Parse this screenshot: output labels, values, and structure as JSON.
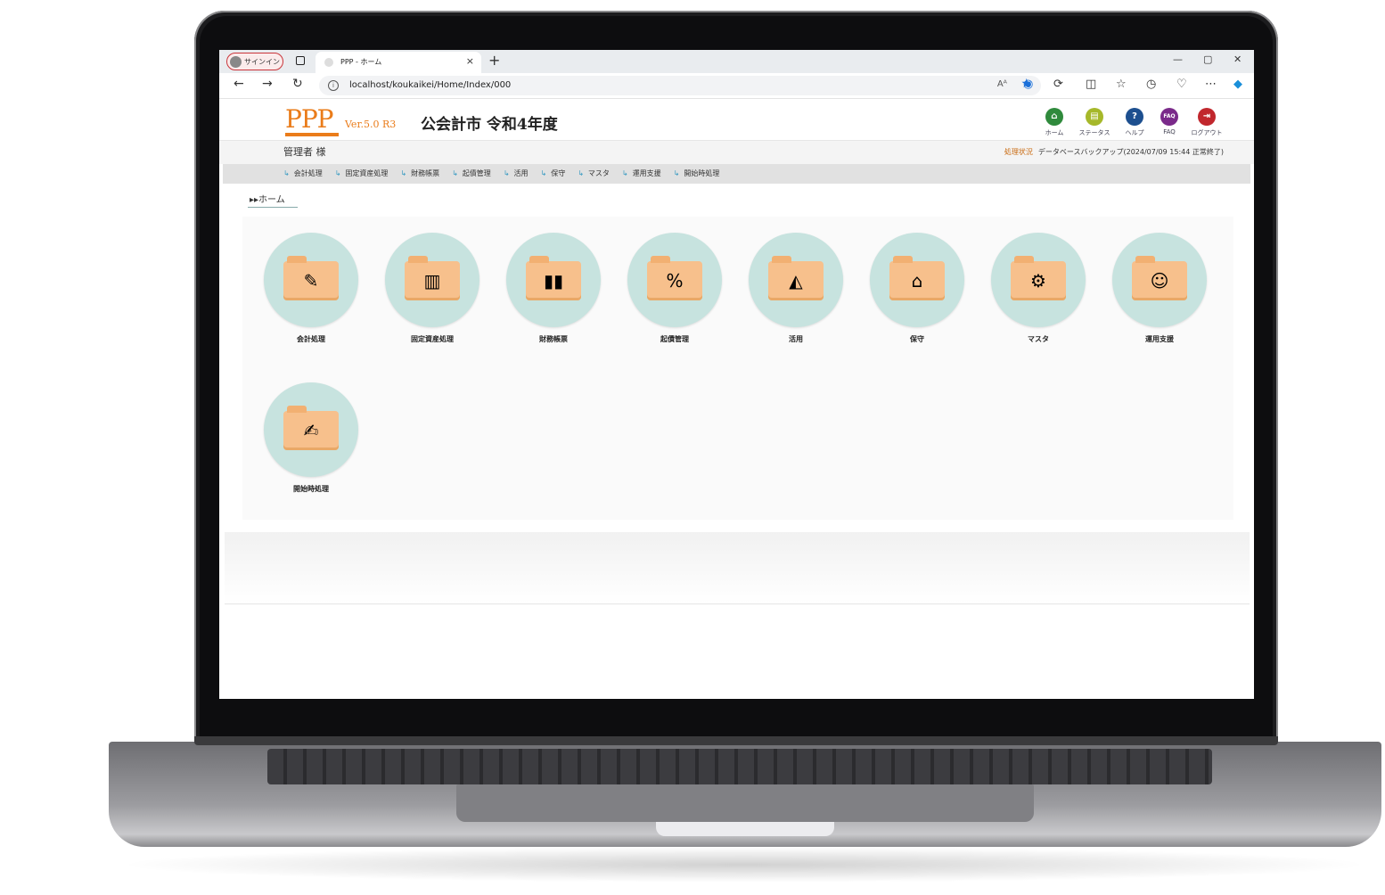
{
  "browser": {
    "signin_label": "サインイン",
    "tab_title": "PPP - ホーム",
    "tab_close": "×",
    "new_tab": "+",
    "url": "localhost/koukaikei/Home/Index/000",
    "read_aloud": "Aᴬ",
    "minimize": "—",
    "maximize": "▢",
    "close": "✕"
  },
  "app": {
    "logo": "PPP",
    "version": "Ver.5.0 R3",
    "city_title": "公会計市  令和4年度",
    "user": "管理者 様",
    "status_key": "処理状況",
    "status_text": "データベースバックアップ(2024/07/09 15:44 正常終了)",
    "header_icons": [
      {
        "label": "ホーム",
        "color": "#2f8a3c",
        "glyph": "⌂",
        "icon": "home-icon"
      },
      {
        "label": "ステータス",
        "color": "#a6b82a",
        "glyph": "▤",
        "icon": "status-icon"
      },
      {
        "label": "ヘルプ",
        "color": "#1d4f8f",
        "glyph": "?",
        "icon": "help-icon"
      },
      {
        "label": "FAQ",
        "color": "#7a2a8a",
        "glyph": "FAQ",
        "icon": "faq-icon"
      },
      {
        "label": "ログアウト",
        "color": "#c1272d",
        "glyph": "⇥",
        "icon": "logout-icon"
      }
    ],
    "menu": [
      "会計処理",
      "固定資産処理",
      "財務帳票",
      "起債管理",
      "活用",
      "保守",
      "マスタ",
      "運用支援",
      "開始時処理"
    ],
    "breadcrumb": "▸▸ホーム",
    "tiles": [
      {
        "label": "会計処理",
        "glyph": "✎",
        "icon": "accounting-icon"
      },
      {
        "label": "固定資産処理",
        "glyph": "▥",
        "icon": "building-icon"
      },
      {
        "label": "財務帳票",
        "glyph": "▮▮",
        "icon": "binders-icon"
      },
      {
        "label": "起債管理",
        "glyph": "%",
        "icon": "percent-icon"
      },
      {
        "label": "活用",
        "glyph": "◭",
        "icon": "chart-icon"
      },
      {
        "label": "保守",
        "glyph": "⌂",
        "icon": "lock-cabinet-icon"
      },
      {
        "label": "マスタ",
        "glyph": "⚙",
        "icon": "gear-window-icon"
      },
      {
        "label": "運用支援",
        "glyph": "☺",
        "icon": "support-person-icon"
      },
      {
        "label": "開始時処理",
        "glyph": "✍",
        "icon": "document-edit-icon"
      }
    ]
  }
}
